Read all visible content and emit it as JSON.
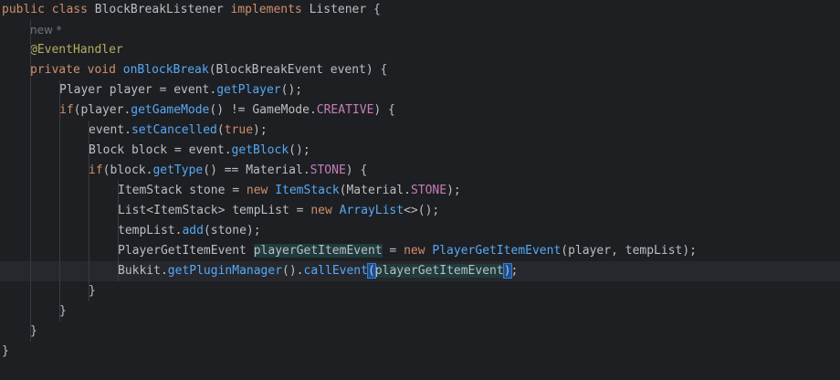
{
  "code": {
    "l1": {
      "kw1": "public",
      "kw2": "class",
      "name": "BlockBreakListener",
      "kw3": "implements",
      "iface": "Listener",
      "brace": "{"
    },
    "l2": {
      "hint": "new *"
    },
    "l3": {
      "annotation": "@EventHandler"
    },
    "l4": {
      "kw1": "private",
      "kw2": "void",
      "method": "onBlockBreak",
      "params": "(BlockBreakEvent event) {"
    },
    "l5": {
      "pre": "Player player = event.",
      "call": "getPlayer",
      "post": "();"
    },
    "l6": {
      "kw": "if",
      "a": "(player.",
      "call": "getGameMode",
      "b": "() != GameMode.",
      "const": "CREATIVE",
      "c": ") {"
    },
    "l7": {
      "a": "event.",
      "call": "setCancelled",
      "b": "(",
      "kw": "true",
      "c": ");"
    },
    "l8": {
      "pre": "Block block = event.",
      "call": "getBlock",
      "post": "();"
    },
    "l9": {
      "kw": "if",
      "a": "(block.",
      "call": "getType",
      "b": "() == Material.",
      "const": "STONE",
      "c": ") {"
    },
    "l10": {
      "a": "ItemStack stone = ",
      "kw": "new",
      "cls": "ItemStack",
      "b": "(Material.",
      "const": "STONE",
      "c": ");"
    },
    "l11": {
      "a": "List<ItemStack> tempList = ",
      "kw": "new",
      "cls": "ArrayList",
      "b": "<>();"
    },
    "l12": {
      "a": "tempList.",
      "call": "add",
      "b": "(stone);"
    },
    "l13": {
      "a": "PlayerGetItemEvent ",
      "var": "playerGetItemEvent",
      "b": " = ",
      "kw": "new",
      "cls": "PlayerGetItemEvent",
      "c": "(player, tempList);"
    },
    "l14": {
      "a": "Bukkit.",
      "call1": "getPluginManager",
      "b": "().",
      "call2": "callEvent",
      "open": "(",
      "var": "playerGetItemEvent",
      "close": ")",
      "semi": ";"
    },
    "l15": {
      "brace": "}"
    },
    "l16": {
      "brace": "}"
    },
    "l17": {
      "brace": "}"
    },
    "l18": {
      "brace": "}"
    }
  },
  "colors": {
    "background": "#1e1f22",
    "keyword": "#cf8e6d",
    "method": "#56a8f5",
    "annotation": "#b3ae60",
    "constant": "#c77dbb",
    "text": "#bcbec4",
    "current_line": "#26282e"
  }
}
